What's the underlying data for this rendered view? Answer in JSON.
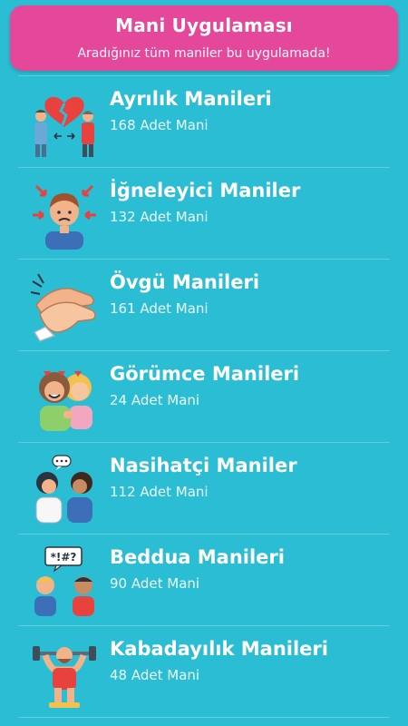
{
  "header": {
    "title": "Mani Uygulaması",
    "subtitle": "Aradığınız tüm maniler bu uygulamada!"
  },
  "categories": [
    {
      "title": "Ayrılık Manileri",
      "count": "168 Adet Mani",
      "icon": "heartbreak-couple-icon"
    },
    {
      "title": "İğneleyici Maniler",
      "count": "132 Adet Mani",
      "icon": "stressed-person-icon"
    },
    {
      "title": "Övgü Manileri",
      "count": "161 Adet Mani",
      "icon": "clapping-hands-icon"
    },
    {
      "title": "Görümce Manileri",
      "count": "24 Adet Mani",
      "icon": "two-women-icon"
    },
    {
      "title": "Nasihatçi Maniler",
      "count": "112 Adet Mani",
      "icon": "conversation-icon"
    },
    {
      "title": "Beddua Manileri",
      "count": "90 Adet Mani",
      "icon": "cursing-people-icon"
    },
    {
      "title": "Kabadayılık Manileri",
      "count": "48 Adet Mani",
      "icon": "strongman-icon"
    }
  ],
  "colors": {
    "background": "#2bbdd3",
    "header": "#e5489a",
    "divider": "#5fcfe0"
  }
}
